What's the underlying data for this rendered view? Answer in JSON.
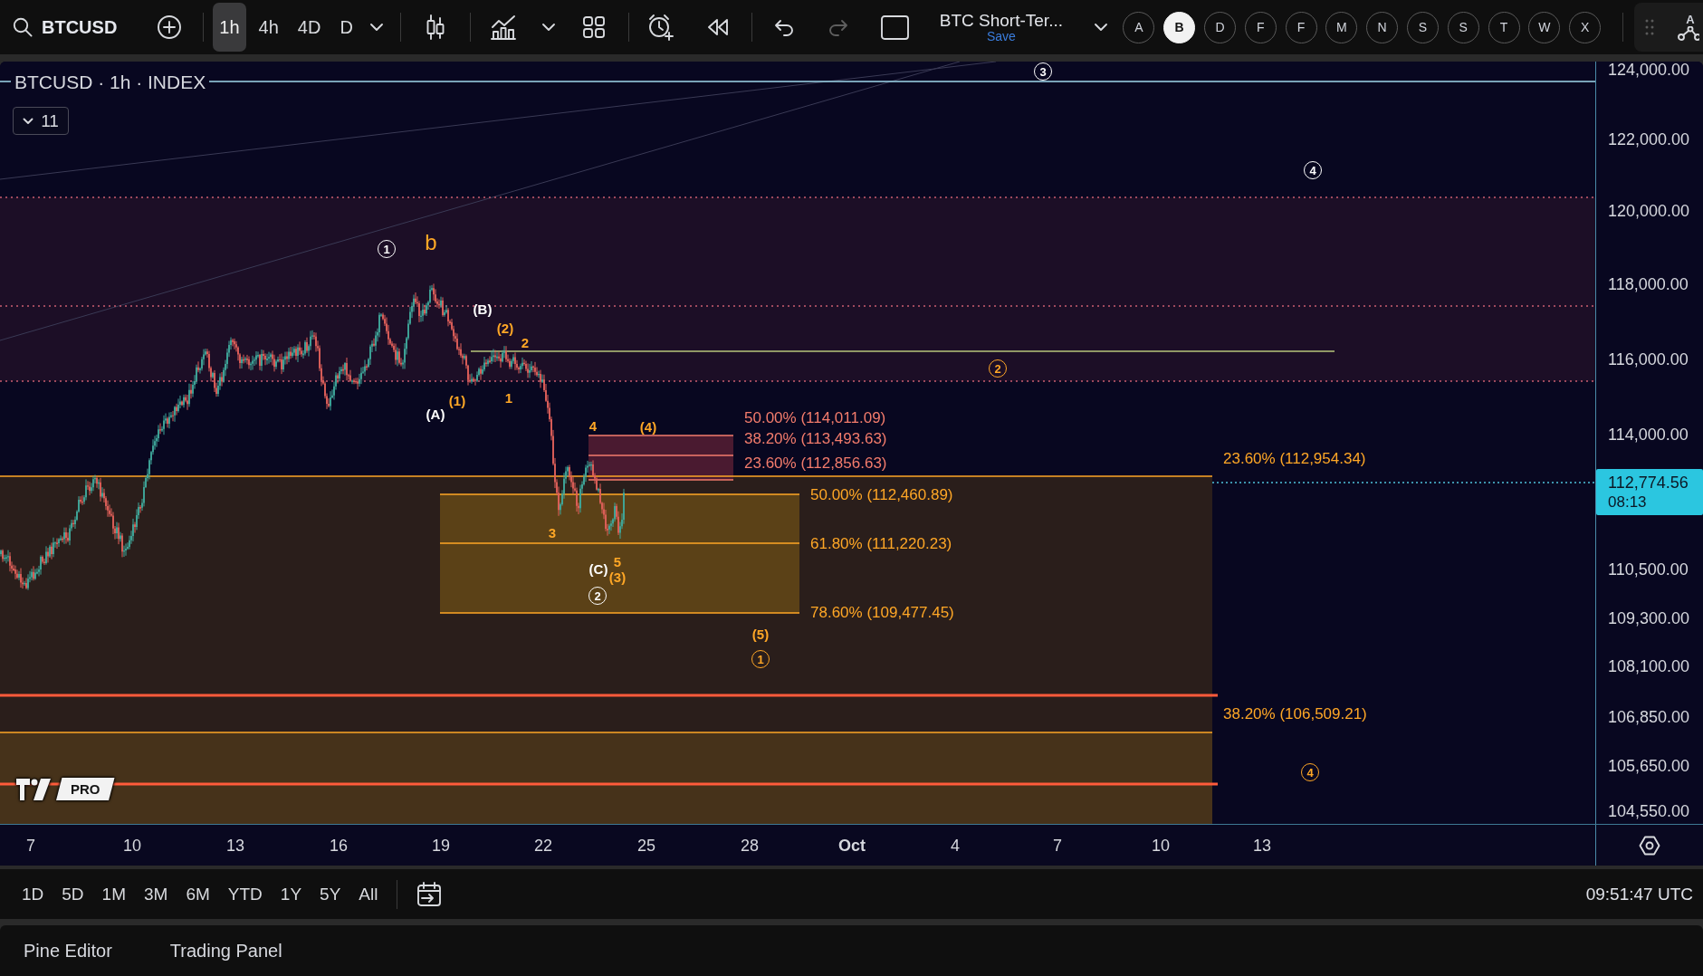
{
  "toolbar": {
    "symbol": "BTCUSD",
    "intervals": [
      {
        "label": "1h",
        "selected": true
      },
      {
        "label": "4h",
        "selected": false
      },
      {
        "label": "4D",
        "selected": false
      },
      {
        "label": "D",
        "selected": false
      }
    ],
    "layout_name": "BTC Short-Ter...",
    "save_label": "Save",
    "letter_buttons": [
      {
        "label": "A",
        "selected": false
      },
      {
        "label": "B",
        "selected": true
      },
      {
        "label": "D",
        "selected": false
      },
      {
        "label": "F",
        "selected": false
      },
      {
        "label": "F",
        "selected": false
      },
      {
        "label": "M",
        "selected": false
      },
      {
        "label": "N",
        "selected": false
      },
      {
        "label": "S",
        "selected": false
      },
      {
        "label": "S",
        "selected": false
      },
      {
        "label": "T",
        "selected": false
      },
      {
        "label": "W",
        "selected": false
      },
      {
        "label": "X",
        "selected": false
      }
    ],
    "corner_letter": "A"
  },
  "chart": {
    "legend": "BTCUSD · 1h · INDEX",
    "indicator_count": "11",
    "wave_labels": [
      {
        "text": "3",
        "kind": "circled",
        "color": "#ffffff"
      },
      {
        "text": "4",
        "kind": "circled",
        "color": "#ffffff"
      },
      {
        "text": "1",
        "kind": "circled",
        "color": "#ffffff"
      },
      {
        "text": "b",
        "kind": "large",
        "color": "#ffa726"
      },
      {
        "text": "(B)",
        "kind": "plain",
        "color": "#ffffff"
      },
      {
        "text": "(2)",
        "kind": "plain",
        "color": "#ffa726"
      },
      {
        "text": "2",
        "kind": "plain",
        "color": "#ffa726"
      },
      {
        "text": "2",
        "kind": "circled",
        "color": "#ffa726"
      },
      {
        "text": "(1)",
        "kind": "plain",
        "color": "#ffa726"
      },
      {
        "text": "1",
        "kind": "plain",
        "color": "#ffa726"
      },
      {
        "text": "(A)",
        "kind": "plain",
        "color": "#ffffff"
      },
      {
        "text": "4",
        "kind": "plain",
        "color": "#ffa726"
      },
      {
        "text": "(4)",
        "kind": "plain",
        "color": "#ffa726"
      },
      {
        "text": "3",
        "kind": "plain",
        "color": "#ffa726"
      },
      {
        "text": "5",
        "kind": "plain",
        "color": "#ffa726"
      },
      {
        "text": "(C)",
        "kind": "plain",
        "color": "#ffffff"
      },
      {
        "text": "(3)",
        "kind": "plain",
        "color": "#ffa726"
      },
      {
        "text": "2",
        "kind": "circled",
        "color": "#ffffff"
      },
      {
        "text": "(5)",
        "kind": "plain",
        "color": "#ffa726"
      },
      {
        "text": "1",
        "kind": "circled",
        "color": "#ffa726"
      },
      {
        "text": "4",
        "kind": "circled",
        "color": "#ffa726"
      }
    ],
    "fib_labels": [
      {
        "text": "50.00% (114,011.09)",
        "color": "#f47c6c"
      },
      {
        "text": "38.20% (113,493.63)",
        "color": "#f47c6c"
      },
      {
        "text": "23.60% (112,856.63)",
        "color": "#f47c6c"
      },
      {
        "text": "23.60% (112,954.34)",
        "color": "#ffa726"
      },
      {
        "text": "50.00% (112,460.89)",
        "color": "#ffa726"
      },
      {
        "text": "61.80% (111,220.23)",
        "color": "#ffa726"
      },
      {
        "text": "78.60% (109,477.45)",
        "color": "#ffa726"
      },
      {
        "text": "38.20% (106,509.21)",
        "color": "#ffa726"
      }
    ],
    "price_axis": [
      "124,000.00",
      "122,000.00",
      "120,000.00",
      "118,000.00",
      "116,000.00",
      "114,000.00",
      "110,500.00",
      "109,300.00",
      "108,100.00",
      "106,850.00",
      "105,650.00",
      "104,550.00"
    ],
    "current_price": {
      "price": "112,774.56",
      "countdown": "08:13"
    },
    "time_axis": [
      {
        "label": "7",
        "kind": "day"
      },
      {
        "label": "10",
        "kind": "day"
      },
      {
        "label": "13",
        "kind": "day"
      },
      {
        "label": "16",
        "kind": "day"
      },
      {
        "label": "19",
        "kind": "day"
      },
      {
        "label": "22",
        "kind": "day"
      },
      {
        "label": "25",
        "kind": "day"
      },
      {
        "label": "28",
        "kind": "day"
      },
      {
        "label": "Oct",
        "kind": "month"
      },
      {
        "label": "4",
        "kind": "day"
      },
      {
        "label": "7",
        "kind": "day"
      },
      {
        "label": "10",
        "kind": "day"
      },
      {
        "label": "13",
        "kind": "day"
      }
    ],
    "logo_badge": "PRO"
  },
  "range_bar": {
    "ranges": [
      "1D",
      "5D",
      "1M",
      "3M",
      "6M",
      "YTD",
      "1Y",
      "5Y",
      "All"
    ],
    "clock": "09:51:47 UTC"
  },
  "bottom_panel": {
    "tabs": [
      "Pine Editor",
      "Trading Panel"
    ]
  }
}
